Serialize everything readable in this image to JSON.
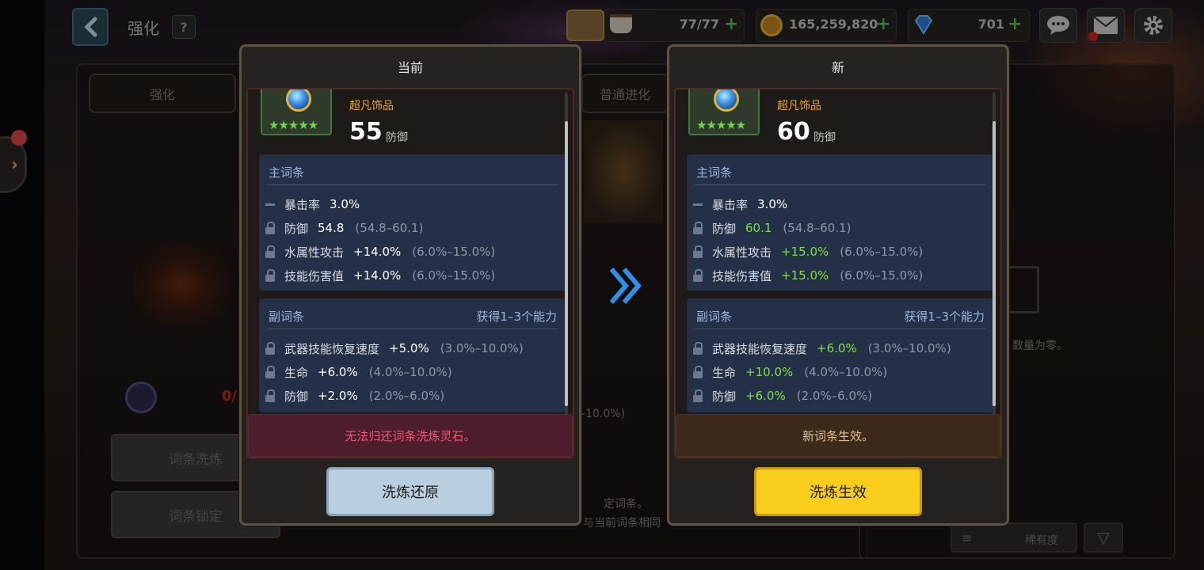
{
  "topbar": {
    "title": "强化",
    "help": "?",
    "stamina": "77/77",
    "gold": "165,259,820",
    "gems": "701"
  },
  "background": {
    "tab_enhance": "强化",
    "tab_evolve": "普通进化",
    "btn_reroll": "词条洗炼",
    "btn_lock": "词条锁定",
    "level_prefix": "0/",
    "chest_note": "数量为零。",
    "hint_line1": "定词条。",
    "hint_line2": "与当前词条相同",
    "partial_range": "-10.0%)",
    "sort_label": "稀有度"
  },
  "current": {
    "header": "当前",
    "grade": "超凡饰品",
    "power": "55",
    "power_label": "防御",
    "stars": "★★★★★",
    "main_title": "主词条",
    "main_stats": [
      {
        "name": "暴击率",
        "value": "3.0%",
        "range": ""
      },
      {
        "name": "防御",
        "value": "54.8",
        "range": "(54.8–60.1)"
      },
      {
        "name": "水属性攻击",
        "value": "+14.0%",
        "range": "(6.0%–15.0%)"
      },
      {
        "name": "技能伤害值",
        "value": "+14.0%",
        "range": "(6.0%–15.0%)"
      }
    ],
    "sub_title": "副词条",
    "sub_gain": "获得1–3个能力",
    "sub_stats": [
      {
        "name": "武器技能恢复速度",
        "value": "+5.0%",
        "range": "(3.0%–10.0%)"
      },
      {
        "name": "生命",
        "value": "+6.0%",
        "range": "(4.0%–10.0%)"
      },
      {
        "name": "防御",
        "value": "+2.0%",
        "range": "(2.0%–6.0%)"
      }
    ],
    "notice": "无法归还词条洗炼灵石。",
    "button": "洗炼还原"
  },
  "new": {
    "header": "新",
    "grade": "超凡饰品",
    "power": "60",
    "power_label": "防御",
    "stars": "★★★★★",
    "main_title": "主词条",
    "main_stats": [
      {
        "name": "暴击率",
        "value": "3.0%",
        "range": ""
      },
      {
        "name": "防御",
        "value": "60.1",
        "range": "(54.8–60.1)"
      },
      {
        "name": "水属性攻击",
        "value": "+15.0%",
        "range": "(6.0%–15.0%)"
      },
      {
        "name": "技能伤害值",
        "value": "+15.0%",
        "range": "(6.0%–15.0%)"
      }
    ],
    "sub_title": "副词条",
    "sub_gain": "获得1–3个能力",
    "sub_stats": [
      {
        "name": "武器技能恢复速度",
        "value": "+6.0%",
        "range": "(3.0%–10.0%)"
      },
      {
        "name": "生命",
        "value": "+10.0%",
        "range": "(4.0%–10.0%)"
      },
      {
        "name": "防御",
        "value": "+6.0%",
        "range": "(2.0%–6.0%)"
      }
    ],
    "notice": "新词条生效。",
    "button": "洗炼生效"
  },
  "colors": {
    "accent_yellow": "#f9cd1c",
    "restore_blue": "#b9cfdf",
    "up_green": "#7ee043",
    "grade_orange": "#e7a63b",
    "arrow_blue": "#2f8fe6"
  }
}
